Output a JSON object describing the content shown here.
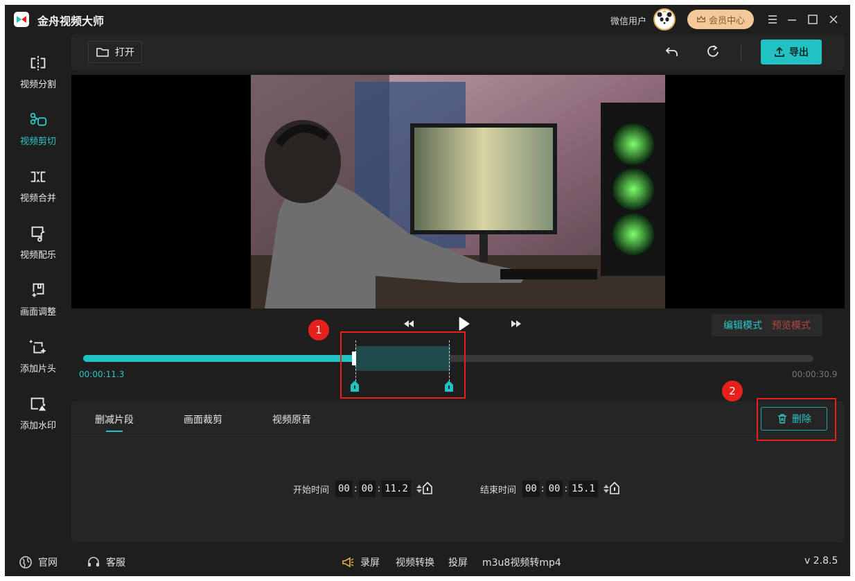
{
  "app": {
    "title": "金舟视频大师"
  },
  "header": {
    "user_name": "微信用户",
    "vip_label": "会员中心"
  },
  "sidebar": {
    "items": [
      {
        "label": "视频分割",
        "icon": "split-icon"
      },
      {
        "label": "视频剪切",
        "icon": "scissors-icon",
        "active": true
      },
      {
        "label": "视频合并",
        "icon": "merge-icon"
      },
      {
        "label": "视频配乐",
        "icon": "music-icon"
      },
      {
        "label": "画面调整",
        "icon": "adjust-icon"
      },
      {
        "label": "添加片头",
        "icon": "intro-icon"
      },
      {
        "label": "添加水印",
        "icon": "watermark-icon"
      }
    ]
  },
  "toolbar": {
    "open_label": "打开",
    "export_label": "导出"
  },
  "player": {
    "mode_edit": "编辑模式",
    "mode_preview": "预览模式",
    "current_time": "00:00:11.3",
    "total_time": "00:00:30.9"
  },
  "panel": {
    "tabs": [
      "删减片段",
      "画面裁剪",
      "视频原音"
    ],
    "delete_label": "删除",
    "start_label": "开始时间",
    "end_label": "结束时间",
    "start": {
      "h": "00",
      "m": "00",
      "s": "11.2"
    },
    "end": {
      "h": "00",
      "m": "00",
      "s": "15.1"
    }
  },
  "annotations": {
    "callout_1": "1",
    "callout_2": "2"
  },
  "statusbar": {
    "website": "官网",
    "support": "客服",
    "record": "录屏",
    "convert": "视频转换",
    "cast": "投屏",
    "m3u8": "m3u8视频转mp4",
    "version": "v 2.8.5"
  },
  "colors": {
    "accent": "#23c2c2",
    "annotation": "#e8201c",
    "background": "#1e1e1e"
  }
}
